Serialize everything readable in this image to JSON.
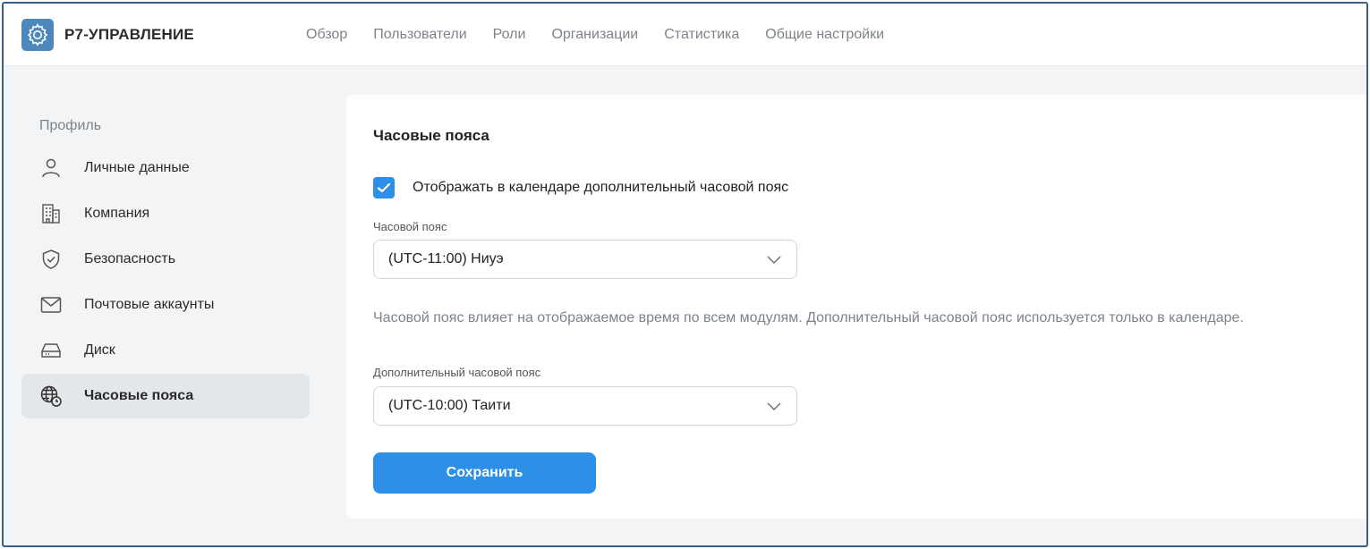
{
  "app": {
    "name": "Р7-УПРАВЛЕНИЕ",
    "logo_icon": "gear-icon",
    "accent_color": "#2d8fe6"
  },
  "nav": {
    "items": [
      "Обзор",
      "Пользователи",
      "Роли",
      "Организации",
      "Статистика",
      "Общие настройки"
    ]
  },
  "sidebar": {
    "heading": "Профиль",
    "items": [
      {
        "label": "Личные данные",
        "icon": "user-icon"
      },
      {
        "label": "Компания",
        "icon": "building-icon"
      },
      {
        "label": "Безопасность",
        "icon": "shield-icon"
      },
      {
        "label": "Почтовые аккаунты",
        "icon": "mail-icon"
      },
      {
        "label": "Диск",
        "icon": "drive-icon"
      },
      {
        "label": "Часовые пояса",
        "icon": "globe-clock-icon",
        "active": true
      }
    ]
  },
  "main": {
    "title": "Часовые пояса",
    "show_extra_tz": {
      "label": "Отображать в календаре дополнительный часовой пояс",
      "checked": true
    },
    "timezone": {
      "label": "Часовой пояс",
      "value": "(UTC-11:00) Ниуэ"
    },
    "hint": "Часовой пояс влияет на отображаемое время по всем модулям. Дополнительный часовой пояс используется только в календаре.",
    "extra_timezone": {
      "label": "Дополнительный часовой пояс",
      "value": "(UTC-10:00) Таити"
    },
    "save_label": "Сохранить"
  }
}
